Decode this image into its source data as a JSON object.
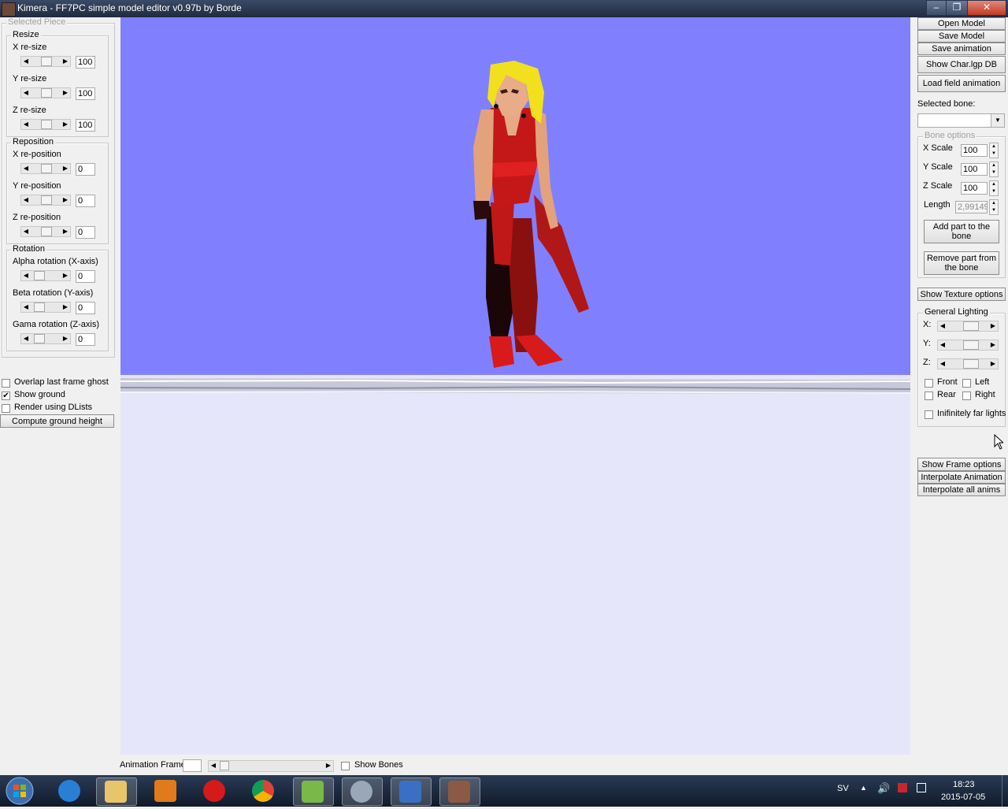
{
  "window": {
    "title": "Kimera - FF7PC simple model editor v0.97b by Borde",
    "minimize": "‒",
    "maximize": "❐",
    "close": "✕"
  },
  "left_panel": {
    "selected_piece": "Selected Piece",
    "resize": {
      "legend": "Resize",
      "rows": [
        {
          "label": "X re-size",
          "value": "100"
        },
        {
          "label": "Y re-size",
          "value": "100"
        },
        {
          "label": "Z re-size",
          "value": "100"
        }
      ]
    },
    "reposition": {
      "legend": "Reposition",
      "rows": [
        {
          "label": "X re-position",
          "value": "0"
        },
        {
          "label": "Y re-position",
          "value": "0"
        },
        {
          "label": "Z re-position",
          "value": "0"
        }
      ]
    },
    "rotation": {
      "legend": "Rotation",
      "rows": [
        {
          "label": "Alpha rotation (X-axis)",
          "value": "0"
        },
        {
          "label": "Beta rotation (Y-axis)",
          "value": "0"
        },
        {
          "label": "Gama rotation (Z-axis)",
          "value": "0"
        }
      ]
    },
    "options": {
      "overlap_ghost": {
        "label": "Overlap last frame ghost",
        "checked": false
      },
      "show_ground": {
        "label": "Show ground",
        "checked": true
      },
      "render_dlists": {
        "label": "Render using DLists",
        "checked": false
      }
    },
    "compute_ground": "Compute ground height"
  },
  "right_panel": {
    "open_model": "Open Model",
    "save_model": "Save Model",
    "save_animation": "Save animation",
    "show_char_db": "Show Char.lgp DB",
    "load_field_anim": "Load field animation",
    "selected_bone_label": "Selected bone:",
    "selected_bone_value": "",
    "bone_options": {
      "legend": "Bone options",
      "x_scale": {
        "label": "X Scale",
        "value": "100"
      },
      "y_scale": {
        "label": "Y Scale",
        "value": "100"
      },
      "z_scale": {
        "label": "Z Scale",
        "value": "100"
      },
      "length": {
        "label": "Length",
        "value": "2,99149"
      },
      "add_part": "Add part to the bone",
      "remove_part": "Remove part from the bone"
    },
    "show_texture": "Show Texture options",
    "lighting": {
      "legend": "General Lighting",
      "x": "X:",
      "y": "Y:",
      "z": "Z:",
      "front": "Front",
      "left": "Left",
      "rear": "Rear",
      "right": "Right",
      "infinite": "Inifinitely far lights"
    },
    "show_frame": "Show Frame options",
    "interpolate_anim": "Interpolate Animation",
    "interpolate_all": "Interpolate all anims"
  },
  "bottom_bar": {
    "anim_frame_label": "Animation Frame",
    "anim_frame_value": "",
    "show_bones": "Show Bones"
  },
  "taskbar": {
    "lang": "SV",
    "time": "18:23",
    "date": "2015-07-05"
  },
  "colors": {
    "sky": "#8080ff",
    "ground": "#e6e6fa",
    "title_bar": "#2b3a55",
    "taskbar": "#1a2538"
  }
}
